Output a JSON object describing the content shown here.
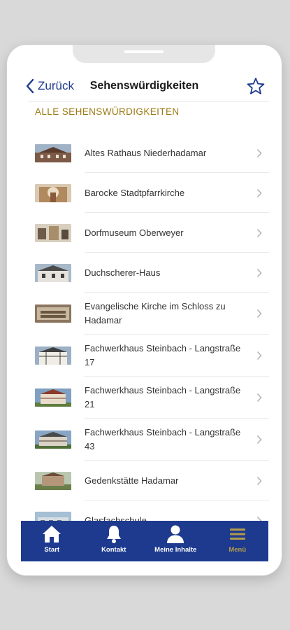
{
  "header": {
    "back_label": "Zurück",
    "title": "Sehenswürdigkeiten"
  },
  "section_title": "ALLE SEHENSWÜRDIGKEITEN",
  "sights": [
    {
      "label": "Altes Rathaus Niederhadamar"
    },
    {
      "label": "Barocke Stadtpfarrkirche"
    },
    {
      "label": "Dorfmuseum Oberweyer"
    },
    {
      "label": "Duchscherer-Haus"
    },
    {
      "label": "Evangelische Kirche im Schloss zu Hadamar"
    },
    {
      "label": "Fachwerkhaus Steinbach - Langstraße 17"
    },
    {
      "label": "Fachwerkhaus Steinbach - Langstraße 21"
    },
    {
      "label": "Fachwerkhaus Steinbach - Langstraße 43"
    },
    {
      "label": "Gedenkstätte Hadamar"
    },
    {
      "label": "Glasfachschule"
    }
  ],
  "tabbar": {
    "items": [
      {
        "label": "Start",
        "icon": "home-icon"
      },
      {
        "label": "Kontakt",
        "icon": "bell-icon"
      },
      {
        "label": "Meine Inhalte",
        "icon": "person-icon"
      },
      {
        "label": "Menü",
        "icon": "hamburger-menu-icon"
      }
    ],
    "active_index": 3
  },
  "colors": {
    "brand_blue": "#1d3a8f",
    "section_gold": "#9c7a12",
    "active_tab_gold": "#b29b4a"
  }
}
